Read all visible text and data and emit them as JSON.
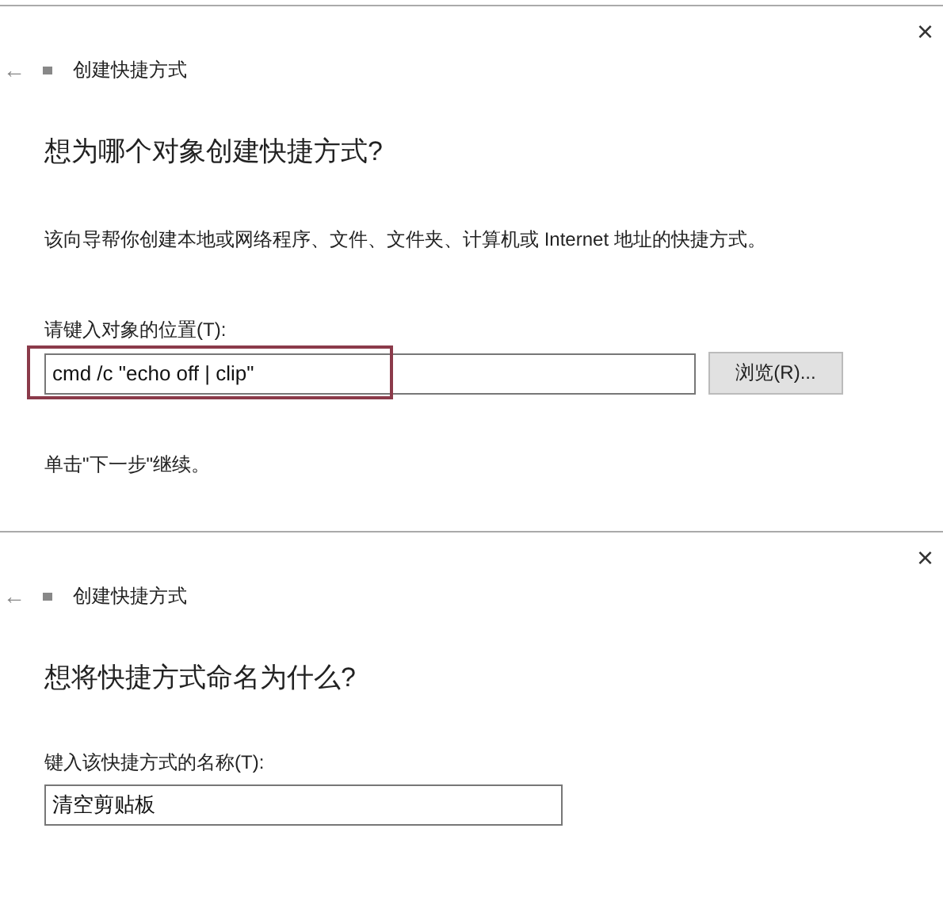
{
  "panels": [
    {
      "window": {
        "title": "创建快捷方式",
        "close": "×",
        "back": "←"
      },
      "heading": "想为哪个对象创建快捷方式?",
      "description": "该向导帮你创建本地或网络程序、文件、文件夹、计算机或 Internet 地址的快捷方式。",
      "field": {
        "label": "请键入对象的位置(T):",
        "value": "cmd /c \"echo off | clip\"",
        "highlighted": true
      },
      "browse_button": "浏览(R)...",
      "hint": "单击\"下一步\"继续。"
    },
    {
      "window": {
        "title": "创建快捷方式",
        "close": "×",
        "back": "←"
      },
      "heading": "想将快捷方式命名为什么?",
      "field": {
        "label": "键入该快捷方式的名称(T):",
        "value": "清空剪贴板",
        "highlighted": false
      }
    }
  ]
}
